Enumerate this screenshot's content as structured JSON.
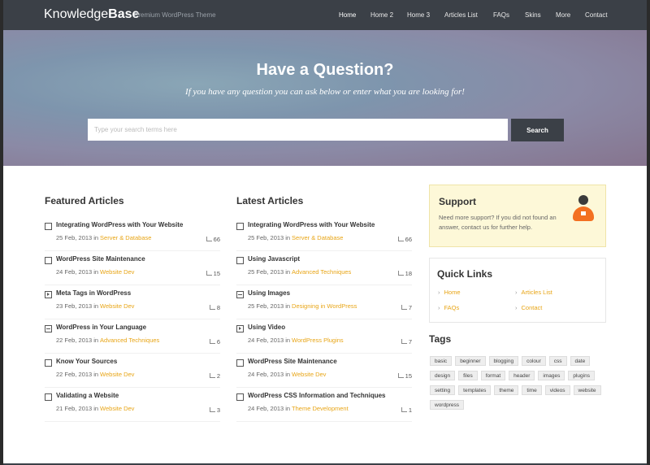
{
  "header": {
    "logo_light": "Knowledge",
    "logo_bold": "Base",
    "tagline": "Premium WordPress Theme",
    "nav": [
      "Home",
      "Home 2",
      "Home 3",
      "Articles List",
      "FAQs",
      "Skins",
      "More",
      "Contact"
    ],
    "active_nav": "Home"
  },
  "hero": {
    "title": "Have a Question?",
    "subtitle": "If you have any question you can ask below or enter what you are looking for!",
    "search_placeholder": "Type your search terms here",
    "search_button": "Search"
  },
  "featured": {
    "title": "Featured Articles",
    "articles": [
      {
        "icon": "doc-icon",
        "title": "Integrating WordPress with Your Website",
        "date": "25 Feb, 2013",
        "category": "Server & Database",
        "likes": "66"
      },
      {
        "icon": "doc-icon",
        "title": "WordPress Site Maintenance",
        "date": "24 Feb, 2013",
        "category": "Website Dev",
        "likes": "15"
      },
      {
        "icon": "video-icon",
        "title": "Meta Tags in WordPress",
        "date": "23 Feb, 2013",
        "category": "Website Dev",
        "likes": "8"
      },
      {
        "icon": "image-icon",
        "title": "WordPress in Your Language",
        "date": "22 Feb, 2013",
        "category": "Advanced Techniques",
        "likes": "6"
      },
      {
        "icon": "doc-icon",
        "title": "Know Your Sources",
        "date": "22 Feb, 2013",
        "category": "Website Dev",
        "likes": "2"
      },
      {
        "icon": "doc-icon",
        "title": "Validating a Website",
        "date": "21 Feb, 2013",
        "category": "Website Dev",
        "likes": "3"
      }
    ]
  },
  "latest": {
    "title": "Latest Articles",
    "articles": [
      {
        "icon": "doc-icon",
        "title": "Integrating WordPress with Your Website",
        "date": "25 Feb, 2013",
        "category": "Server & Database",
        "likes": "66"
      },
      {
        "icon": "doc-icon",
        "title": "Using Javascript",
        "date": "25 Feb, 2013",
        "category": "Advanced Techniques",
        "likes": "18"
      },
      {
        "icon": "image-icon",
        "title": "Using Images",
        "date": "25 Feb, 2013",
        "category": "Designing in WordPress",
        "likes": "7"
      },
      {
        "icon": "video-icon",
        "title": "Using Video",
        "date": "24 Feb, 2013",
        "category": "WordPress Plugins",
        "likes": "7"
      },
      {
        "icon": "doc-icon",
        "title": "WordPress Site Maintenance",
        "date": "24 Feb, 2013",
        "category": "Website Dev",
        "likes": "15"
      },
      {
        "icon": "doc-icon",
        "title": "WordPress CSS Information and Techniques",
        "date": "24 Feb, 2013",
        "category": "Theme Development",
        "likes": "1"
      }
    ]
  },
  "meta_in": "in",
  "support": {
    "title": "Support",
    "text": "Need more support? If you did not found an answer, contact us for further help."
  },
  "quick_links": {
    "title": "Quick Links",
    "links": [
      "Home",
      "Articles List",
      "FAQs",
      "Contact"
    ]
  },
  "tags": {
    "title": "Tags",
    "items": [
      "basic",
      "beginner",
      "blogging",
      "colour",
      "css",
      "date",
      "design",
      "files",
      "format",
      "header",
      "images",
      "plugins",
      "setting",
      "templates",
      "theme",
      "time",
      "videos",
      "website",
      "wordpress"
    ]
  },
  "colors": {
    "accent": "#e8a516",
    "topbar": "#3b4047",
    "support_bg": "#fdf8d8"
  }
}
